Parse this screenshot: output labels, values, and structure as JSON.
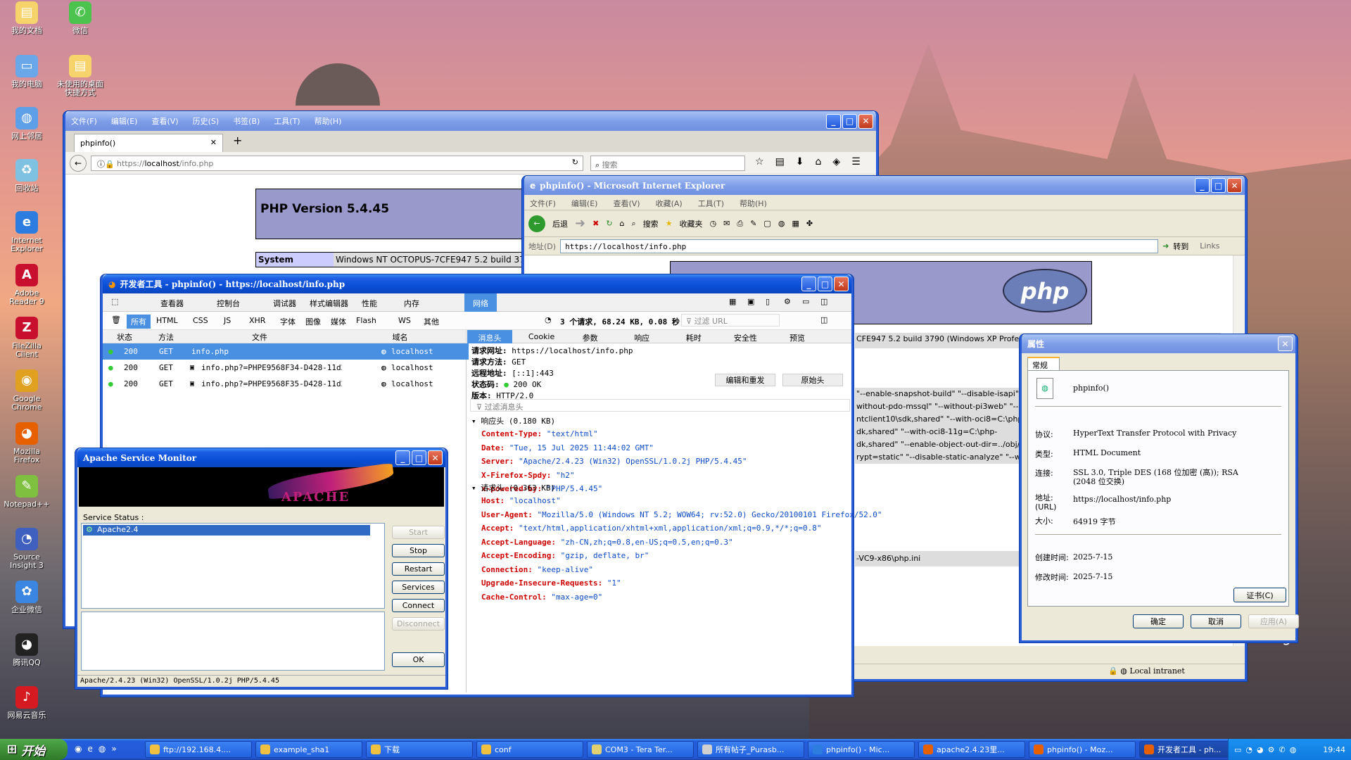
{
  "desktop_icons": [
    {
      "label": "我的文档",
      "color": "#f6d36b",
      "glyph": "▤"
    },
    {
      "label": "微信",
      "color": "#4cc34f",
      "glyph": "✆"
    },
    {
      "label": "我的电脑",
      "color": "#6aa7e8",
      "glyph": "▭"
    },
    {
      "label": "未使用的桌面快捷方式",
      "color": "#f6d36b",
      "glyph": "▤"
    },
    {
      "label": "网上邻居",
      "color": "#5ea0e8",
      "glyph": "◍"
    },
    {
      "label": "回收站",
      "color": "#7fc1e0",
      "glyph": "♻"
    },
    {
      "label": "Internet Explorer",
      "color": "#2d7de0",
      "glyph": "e"
    },
    {
      "label": "Adobe Reader 9",
      "color": "#c8102e",
      "glyph": "A"
    },
    {
      "label": "FileZilla Client",
      "color": "#c8102e",
      "glyph": "Z"
    },
    {
      "label": "Google Chrome",
      "color": "#e0a020",
      "glyph": "◉"
    },
    {
      "label": "Mozilla Firefox",
      "color": "#e66000",
      "glyph": "◕"
    },
    {
      "label": "Notepad++",
      "color": "#80c040",
      "glyph": "✎"
    },
    {
      "label": "Source Insight 3",
      "color": "#4060c0",
      "glyph": "◔"
    },
    {
      "label": "企业微信",
      "color": "#3a86e0",
      "glyph": "✿"
    },
    {
      "label": "腾讯QQ",
      "color": "#222",
      "glyph": "◕"
    },
    {
      "label": "网易云音乐",
      "color": "#d51a22",
      "glyph": "♪"
    }
  ],
  "firefox": {
    "menu": [
      "文件(F)",
      "编辑(E)",
      "查看(V)",
      "历史(S)",
      "书签(B)",
      "工具(T)",
      "帮助(H)"
    ],
    "tab": "phpinfo()",
    "url_prefix": "https://",
    "url_host": "localhost",
    "url_path": "/info.php",
    "search_placeholder": "搜索",
    "php_version": "PHP Version 5.4.45",
    "system_label": "System",
    "system_value": "Windows NT OCTOPUS-7CFE947 5.2 build 37"
  },
  "ie": {
    "title": "phpinfo() - Microsoft Internet Explorer",
    "menu": [
      "文件(F)",
      "编辑(E)",
      "查看(V)",
      "收藏(A)",
      "工具(T)",
      "帮助(H)"
    ],
    "back": "后退",
    "search": "搜索",
    "favorites": "收藏夹",
    "address_label": "地址(D)",
    "address": "https://localhost/info.php",
    "go": "转到",
    "links": "Links",
    "php_logo": "php",
    "rows": [
      "CFE947 5.2 build 3790 (Windows XP Profess",
      "\"--enable-snapshot-build\" \"--disable-isapi\" \"",
      "without-pdo-mssql\" \"--without-pi3web\" \"--w",
      "ntclient10\\sdk,shared\" \"--with-oci8=C:\\php",
      "dk,shared\" \"--with-oci8-11g=C:\\php-",
      "dk,shared\" \"--enable-object-out-dir=../obj/",
      "rypt=static\" \"--disable-static-analyze\" \"--wit"
    ],
    "ini_path": "-VC9-x86\\php.ini",
    "status_zone": "Local intranet",
    "bing": "Bing"
  },
  "devtools": {
    "title": "开发者工具 - phpinfo() - https://localhost/info.php",
    "tabs": [
      "查看器",
      "控制台",
      "调试器",
      "样式编辑器",
      "性能",
      "内存",
      "网络"
    ],
    "filters": [
      "所有",
      "HTML",
      "CSS",
      "JS",
      "XHR",
      "字体",
      "图像",
      "媒体",
      "Flash",
      "WS",
      "其他"
    ],
    "summary": "3 个请求, 68.24 KB, 0.08 秒",
    "filter_url_placeholder": "过滤 URL",
    "cols": [
      "状态",
      "方法",
      "文件",
      "域名"
    ],
    "requests": [
      {
        "status": "200",
        "method": "GET",
        "file": "info.php",
        "domain": "localhost"
      },
      {
        "status": "200",
        "method": "GET",
        "file": "info.php?=PHPE9568F34-D428-11d2-···",
        "domain": "localhost"
      },
      {
        "status": "200",
        "method": "GET",
        "file": "info.php?=PHPE9568F35-D428-11d2-···",
        "domain": "localhost"
      }
    ],
    "detail_tabs": [
      "消息头",
      "Cookie",
      "参数",
      "响应",
      "耗时",
      "安全性",
      "预览"
    ],
    "req_url_label": "请求网址:",
    "req_url": "https://localhost/info.php",
    "req_method_label": "请求方法:",
    "req_method": "GET",
    "remote_label": "远程地址:",
    "remote": "[::1]:443",
    "status_label": "状态码:",
    "status": "200 OK",
    "version_label": "版本:",
    "version": "HTTP/2.0",
    "edit_resend": "编辑和重发",
    "raw_headers": "原始头",
    "filter_headers": "过滤消息头",
    "resp_section": "响应头 (0.180 KB)",
    "resp_headers": [
      {
        "k": "Content-Type:",
        "v": "\"text/html\""
      },
      {
        "k": "Date:",
        "v": "\"Tue, 15 Jul 2025 11:44:02 GMT\""
      },
      {
        "k": "Server:",
        "v": "\"Apache/2.4.23 (Win32) OpenSSL/1.0.2j PHP/5.4.45\""
      },
      {
        "k": "X-Firefox-Spdy:",
        "v": "\"h2\""
      },
      {
        "k": "x-powered-by:",
        "v": "\"PHP/5.4.45\""
      }
    ],
    "req_section": "请求头 (0.363 KB)",
    "req_headers": [
      {
        "k": "Host:",
        "v": "\"localhost\""
      },
      {
        "k": "User-Agent:",
        "v": "\"Mozilla/5.0 (Windows NT 5.2; WOW64; rv:52.0) Gecko/20100101 Firefox/52.0\""
      },
      {
        "k": "Accept:",
        "v": "\"text/html,application/xhtml+xml,application/xml;q=0.9,*/*;q=0.8\""
      },
      {
        "k": "Accept-Language:",
        "v": "\"zh-CN,zh;q=0.8,en-US;q=0.5,en;q=0.3\""
      },
      {
        "k": "Accept-Encoding:",
        "v": "\"gzip, deflate, br\""
      },
      {
        "k": "Connection:",
        "v": "\"keep-alive\""
      },
      {
        "k": "Upgrade-Insecure-Requests:",
        "v": "\"1\""
      },
      {
        "k": "Cache-Control:",
        "v": "\"max-age=0\""
      }
    ]
  },
  "apache": {
    "title": "Apache Service Monitor",
    "logo": "APACHE",
    "service_status": "Service Status :",
    "service": "Apache2.4",
    "buttons": {
      "start": "Start",
      "stop": "Stop",
      "restart": "Restart",
      "services": "Services",
      "connect": "Connect",
      "disconnect": "Disconnect",
      "ok": "OK"
    },
    "status_bar": "Apache/2.4.23 (Win32) OpenSSL/1.0.2j PHP/5.4.45"
  },
  "props": {
    "title": "属性",
    "tab": "常规",
    "name": "phpinfo()",
    "protocol_label": "协议:",
    "protocol": "HyperText Transfer Protocol with Privacy",
    "type_label": "类型:",
    "type": "HTML Document",
    "conn_label": "连接:",
    "conn": "SSL 3.0, Triple DES (168 位加密 (高)); RSA",
    "conn2": "(2048 位交换)",
    "addr_label": "地址:",
    "addr_label2": "(URL)",
    "addr": "https://localhost/info.php",
    "size_label": "大小:",
    "size": "64919 字节",
    "created_label": "创建时间:",
    "created": "2025-7-15",
    "modified_label": "修改时间:",
    "modified": "2025-7-15",
    "cert": "证书(C)",
    "ok": "确定",
    "cancel": "取消",
    "apply": "应用(A)"
  },
  "taskbar": {
    "start": "开始",
    "tasks": [
      "ftp://192.168.4....",
      "example_sha1",
      "下载",
      "conf",
      "COM3 - Tera Ter...",
      "所有帖子_Purasb...",
      "phpinfo() - Mic...",
      "apache2.4.23里...",
      "phpinfo() - Moz...",
      "开发者工具 - ph..."
    ],
    "clock": "19:44"
  }
}
